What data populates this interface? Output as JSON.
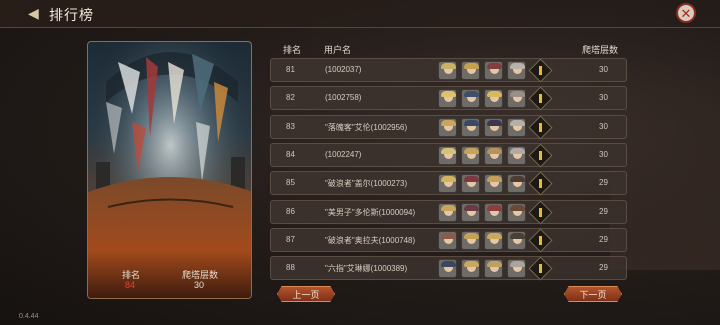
{
  "header": {
    "title": "排行榜",
    "back_icon": "back-arrow-icon",
    "close_icon": "close-icon"
  },
  "my_rank": {
    "rank_label": "排名",
    "rank_value": "84",
    "floor_label": "爬塔层数",
    "floor_value": "30"
  },
  "table": {
    "columns": [
      "排名",
      "用户名",
      "爬塔层数"
    ],
    "rows": [
      {
        "rank": "81",
        "name": "(1002037)",
        "floor": "30",
        "heroes": [
          "#c9b167",
          "#c5a24e",
          "#7f3f3f",
          "#b8b3a8"
        ]
      },
      {
        "rank": "82",
        "name": "(1002758)",
        "floor": "30",
        "heroes": [
          "#e0c06a",
          "#3f4f6a",
          "#d9b85e",
          "#9a8f87"
        ]
      },
      {
        "rank": "83",
        "name": "\"落魄客\"艾伦(1002956)",
        "floor": "30",
        "heroes": [
          "#c9a65a",
          "#3a4a66",
          "#3b3750",
          "#b6b0aa"
        ]
      },
      {
        "rank": "84",
        "name": "(1002247)",
        "floor": "30",
        "heroes": [
          "#d7c177",
          "#c6a25a",
          "#b9925a",
          "#b3aba3"
        ]
      },
      {
        "rank": "85",
        "name": "\"破浪者\"盖尔(1000273)",
        "floor": "29",
        "heroes": [
          "#d2b45f",
          "#7a3a3f",
          "#c3a15a",
          "#4b3d33"
        ]
      },
      {
        "rank": "86",
        "name": "\"美男子\"多伦斯(1000094)",
        "floor": "29",
        "heroes": [
          "#c8a55a",
          "#6a3b44",
          "#8d3e3d",
          "#6a4a37"
        ]
      },
      {
        "rank": "87",
        "name": "\"破浪者\"奥拉夫(1000748)",
        "floor": "29",
        "heroes": [
          "#8a5a4a",
          "#c4a155",
          "#caa95d",
          "#4a3f35"
        ]
      },
      {
        "rank": "88",
        "name": "\"六指\"艾琳娜(1000389)",
        "floor": "29",
        "heroes": [
          "#3b4660",
          "#c9a75c",
          "#bfa060",
          "#aaa49c"
        ]
      }
    ]
  },
  "pagination": {
    "prev_label": "上一页",
    "next_label": "下一页"
  },
  "version": "0.4.44"
}
